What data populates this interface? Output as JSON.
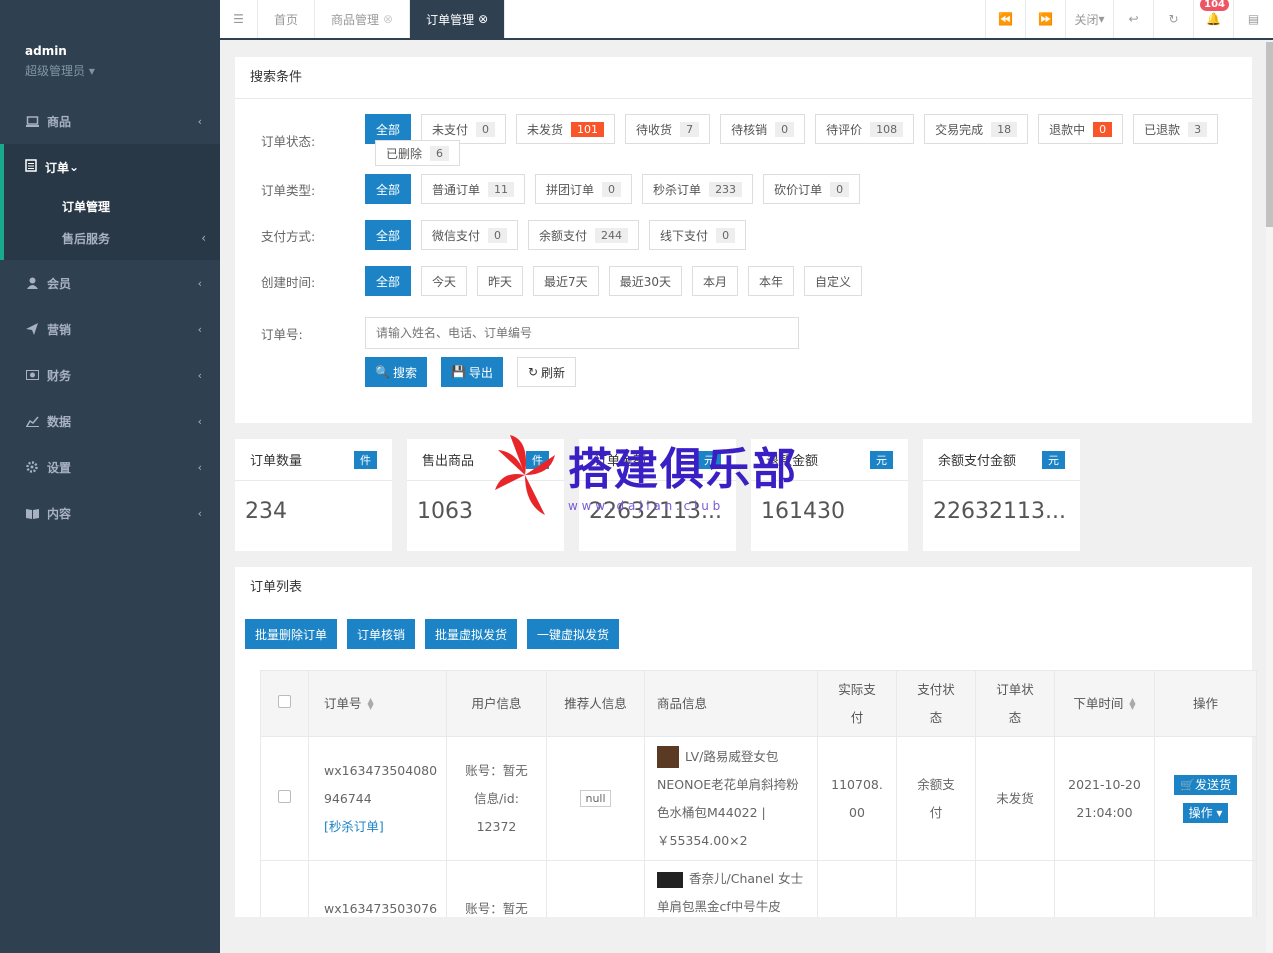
{
  "sidebar": {
    "username": "admin",
    "role": "超级管理员",
    "items": [
      {
        "label": "商品",
        "icon": "laptop-icon"
      },
      {
        "label": "订单",
        "icon": "list-icon",
        "sub": [
          "订单管理",
          "售后服务"
        ]
      },
      {
        "label": "会员",
        "icon": "user-icon"
      },
      {
        "label": "营销",
        "icon": "send-icon"
      },
      {
        "label": "财务",
        "icon": "money-icon"
      },
      {
        "label": "数据",
        "icon": "chart-icon"
      },
      {
        "label": "设置",
        "icon": "gear-icon"
      },
      {
        "label": "内容",
        "icon": "book-icon"
      }
    ]
  },
  "topbar": {
    "tabs": [
      "首页",
      "商品管理",
      "订单管理"
    ],
    "close_label": "关闭",
    "notify_count": "104"
  },
  "search": {
    "title": "搜索条件",
    "status_label": "订单状态:",
    "status": [
      [
        "全部",
        ""
      ],
      [
        "未支付",
        "0"
      ],
      [
        "未发货",
        "101"
      ],
      [
        "待收货",
        "7"
      ],
      [
        "待核销",
        "0"
      ],
      [
        "待评价",
        "108"
      ],
      [
        "交易完成",
        "18"
      ],
      [
        "退款中",
        "0"
      ],
      [
        "已退款",
        "3"
      ],
      [
        "已删除",
        "6"
      ]
    ],
    "type_label": "订单类型:",
    "types": [
      [
        "全部",
        ""
      ],
      [
        "普通订单",
        "11"
      ],
      [
        "拼团订单",
        "0"
      ],
      [
        "秒杀订单",
        "233"
      ],
      [
        "砍价订单",
        "0"
      ]
    ],
    "pay_label": "支付方式:",
    "pays": [
      [
        "全部",
        ""
      ],
      [
        "微信支付",
        "0"
      ],
      [
        "余额支付",
        "244"
      ],
      [
        "线下支付",
        "0"
      ]
    ],
    "time_label": "创建时间:",
    "times": [
      "全部",
      "今天",
      "昨天",
      "最近7天",
      "最近30天",
      "本月",
      "本年",
      "自定义"
    ],
    "no_label": "订单号:",
    "placeholder": "请输入姓名、电话、订单编号",
    "btn_search": "搜索",
    "btn_export": "导出",
    "btn_refresh": "刷新"
  },
  "stats": [
    {
      "label": "订单数量",
      "unit": "件",
      "value": "234"
    },
    {
      "label": "售出商品",
      "unit": "件",
      "value": "1063"
    },
    {
      "label": "订单金额",
      "unit": "元",
      "value": "22632113..."
    },
    {
      "label": "退款金额",
      "unit": "元",
      "value": "161430"
    },
    {
      "label": "余额支付金额",
      "unit": "元",
      "value": "22632113..."
    }
  ],
  "list": {
    "title": "订单列表",
    "actions": [
      "批量删除订单",
      "订单核销",
      "批量虚拟发货",
      "一键虚拟发货"
    ],
    "headers": [
      "订单号",
      "用户信息",
      "推荐人信息",
      "商品信息",
      "实际支付",
      "支付状态",
      "订单状态",
      "下单时间",
      "操作"
    ],
    "rows": [
      {
        "no1": "wx163473504080",
        "no2": "946744",
        "tag": "[秒杀订单]",
        "user1": "账号：暂无",
        "user2": "信息/id:",
        "user3": "12372",
        "ref": "null",
        "goods": "LV/路易威登女包 NEONOE老花单肩斜挎粉色水桶包M44022 | ￥55354.00×2",
        "pay1": "110708.",
        "pay2": "00",
        "paystat": "余额支付",
        "stat": "未发货",
        "time1": "2021-10-20",
        "time2": "21:04:00",
        "op1": "发送货",
        "op2": "操作"
      },
      {
        "no1": "wx163473503076",
        "user1": "账号：暂无",
        "goods": "香奈儿/Chanel 女士单肩包黑金cf中号牛皮"
      }
    ]
  },
  "watermark": {
    "text": "搭建俱乐部",
    "sub": "w w w . d a j i a n . c l u b"
  }
}
